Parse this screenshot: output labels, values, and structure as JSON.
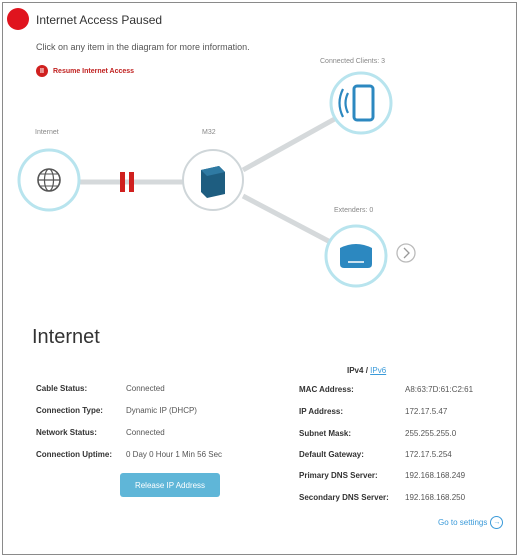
{
  "status": {
    "title": "Internet Access Paused",
    "color": "#e0141e"
  },
  "hint": "Click on any item in the diagram for more information.",
  "resume": {
    "icon": "pause-icon",
    "label": "Resume Internet Access"
  },
  "diagram": {
    "internet_label": "Internet",
    "router_label": "M32",
    "clients_label": "Connected Clients: 3",
    "extenders_label": "Extenders: 0"
  },
  "section": {
    "title": "Internet"
  },
  "left_fields": [
    {
      "label": "Cable Status:",
      "value": "Connected"
    },
    {
      "label": "Connection Type:",
      "value": "Dynamic IP (DHCP)"
    },
    {
      "label": "Network Status:",
      "value": "Connected"
    },
    {
      "label": "Connection Uptime:",
      "value": "0 Day 0 Hour 1 Min 56 Sec"
    }
  ],
  "ip_toggle": {
    "active": "IPv4",
    "separator": "/",
    "inactive": "IPv6"
  },
  "right_fields": [
    {
      "label": "MAC Address:",
      "value": "A8:63:7D:61:C2:61"
    },
    {
      "label": "IP Address:",
      "value": "172.17.5.47"
    },
    {
      "label": "Subnet Mask:",
      "value": "255.255.255.0"
    },
    {
      "label": "Default Gateway:",
      "value": "172.17.5.254"
    },
    {
      "label": "Primary DNS Server:",
      "value": "192.168.168.249"
    },
    {
      "label": "Secondary DNS Server:",
      "value": "192.168.168.250"
    }
  ],
  "release_button": "Release IP Address",
  "goto_settings": "Go to settings",
  "colors": {
    "accent": "#3a9ad9",
    "node_ring": "#b8e4ee",
    "line": "#d5d9db",
    "paused": "#d0201f"
  }
}
